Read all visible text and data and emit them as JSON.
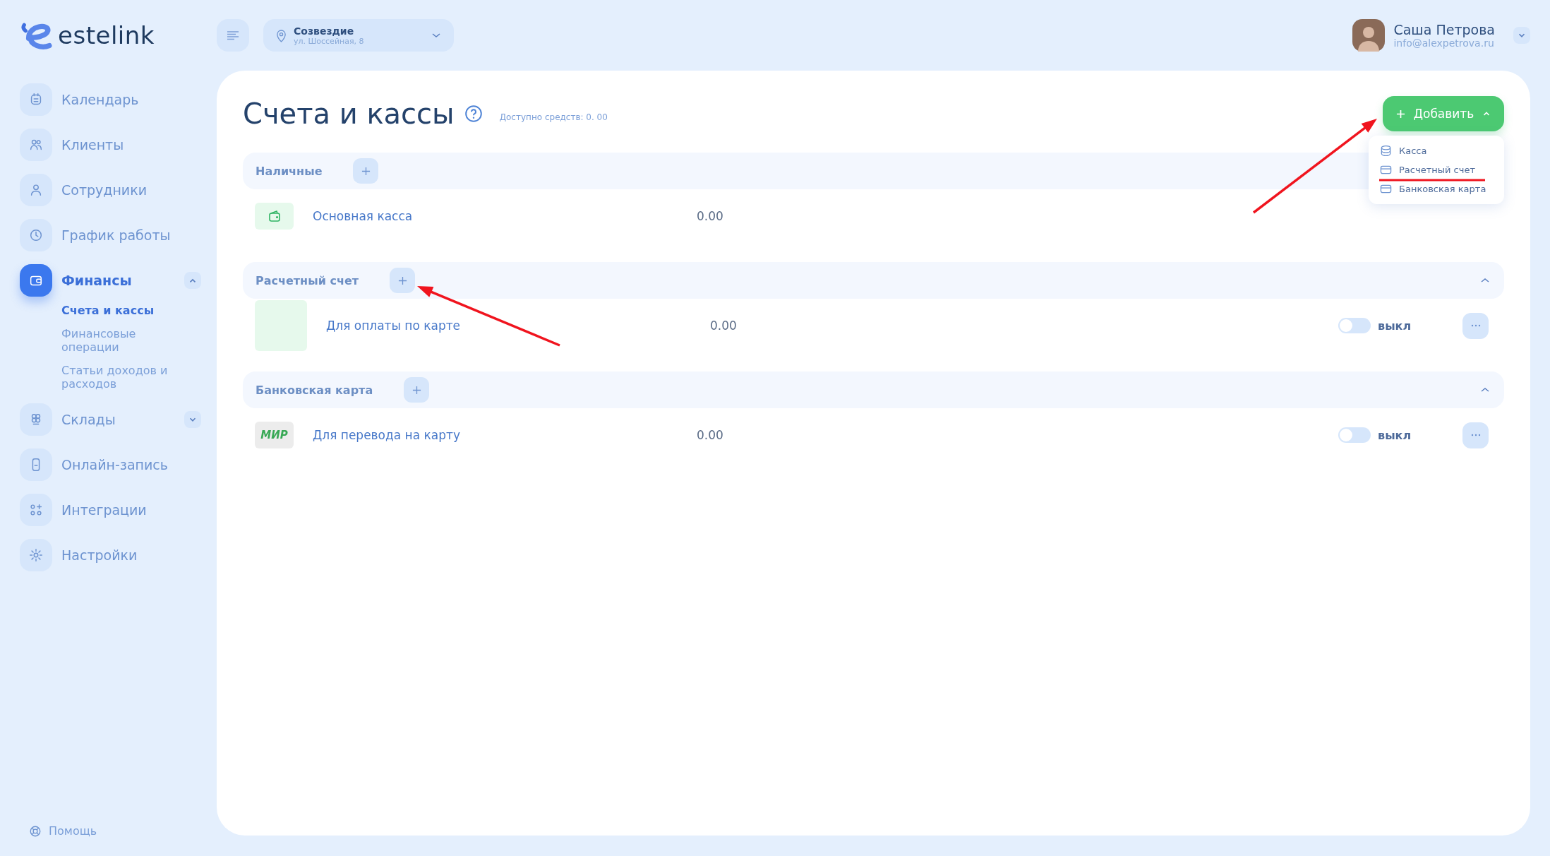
{
  "logo": {
    "text": "estelink"
  },
  "header": {
    "location": {
      "name": "Созвездие",
      "address": "ул. Шоссейная, 8"
    },
    "user": {
      "name": "Саша Петрова",
      "email": "info@alexpetrova.ru"
    }
  },
  "sidebar": {
    "items": [
      {
        "kind": "calendar",
        "label": "Календарь",
        "selected": false
      },
      {
        "kind": "clients",
        "label": "Клиенты",
        "selected": false
      },
      {
        "kind": "person",
        "label": "Сотрудники",
        "selected": false
      },
      {
        "kind": "clock",
        "label": "График работы",
        "selected": false
      },
      {
        "kind": "wallet",
        "label": "Финансы",
        "selected": true,
        "expanded": true,
        "children": [
          {
            "label": "Счета и кассы",
            "selected": true
          },
          {
            "label": "Финансовые операции",
            "selected": false
          },
          {
            "label": "Статьи доходов и расходов",
            "selected": false
          }
        ]
      },
      {
        "kind": "boxes",
        "label": "Склады",
        "selected": false,
        "expanded": false
      },
      {
        "kind": "phone",
        "label": "Онлайн-запись",
        "selected": false
      },
      {
        "kind": "grid",
        "label": "Интеграции",
        "selected": false
      },
      {
        "kind": "gear",
        "label": "Настройки",
        "selected": false
      }
    ],
    "help": "Помощь"
  },
  "page": {
    "title": "Счета и кассы",
    "available": "Доступно средств: 0. 00",
    "add_button": "Добавить",
    "add_menu": {
      "expanded": true,
      "items": [
        {
          "kind": "coins",
          "label": "Касса"
        },
        {
          "kind": "card",
          "label": "Расчетный счет"
        },
        {
          "kind": "card",
          "label": "Банковская карта"
        }
      ]
    }
  },
  "sections": [
    {
      "title": "Наличные",
      "rows": [
        {
          "kind": "wallet",
          "name": "Основная касса",
          "amount": "0.00"
        }
      ]
    },
    {
      "title": "Расчетный счет",
      "expanded": true,
      "rows": [
        {
          "kind": "card",
          "name": "Для оплаты по карте",
          "amount": "0.00",
          "toggle": {
            "on": false,
            "label": "выкл"
          }
        }
      ]
    },
    {
      "title": "Банковская карта",
      "expanded": true,
      "rows": [
        {
          "kind": "mir",
          "logo_text": "МИР",
          "name": "Для перевода на карту",
          "amount": "0.00",
          "toggle": {
            "on": false,
            "label": "выкл"
          }
        }
      ]
    }
  ],
  "annotations": [
    {
      "kind": "arrow"
    },
    {
      "kind": "arrow"
    },
    {
      "kind": "underline"
    }
  ]
}
